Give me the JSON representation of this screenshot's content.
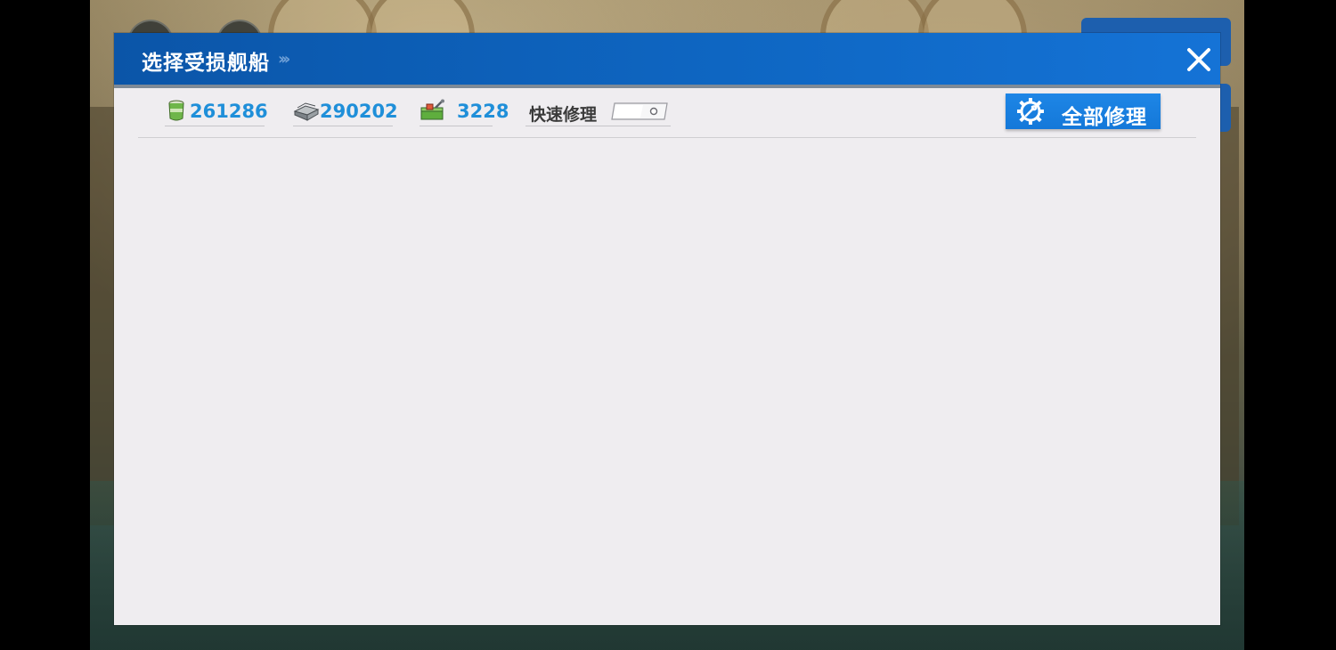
{
  "dialog": {
    "title": "选择受损舰船",
    "close_icon": "close-icon",
    "header_color": "#0e66c2"
  },
  "resources": [
    {
      "name": "fuel",
      "icon": "fuel-barrel-icon",
      "value": "261286"
    },
    {
      "name": "steel",
      "icon": "steel-ingot-icon",
      "value": "290202"
    },
    {
      "name": "repair",
      "icon": "repair-kit-icon",
      "value": "3228"
    }
  ],
  "quick_repair": {
    "label": "快速修理",
    "enabled": false
  },
  "repair_all": {
    "label": "全部修理",
    "icon": "gear-wrench-icon"
  },
  "colors": {
    "accent": "#1f8fd9",
    "panel": "#efedf0",
    "button": "#1478d9"
  }
}
